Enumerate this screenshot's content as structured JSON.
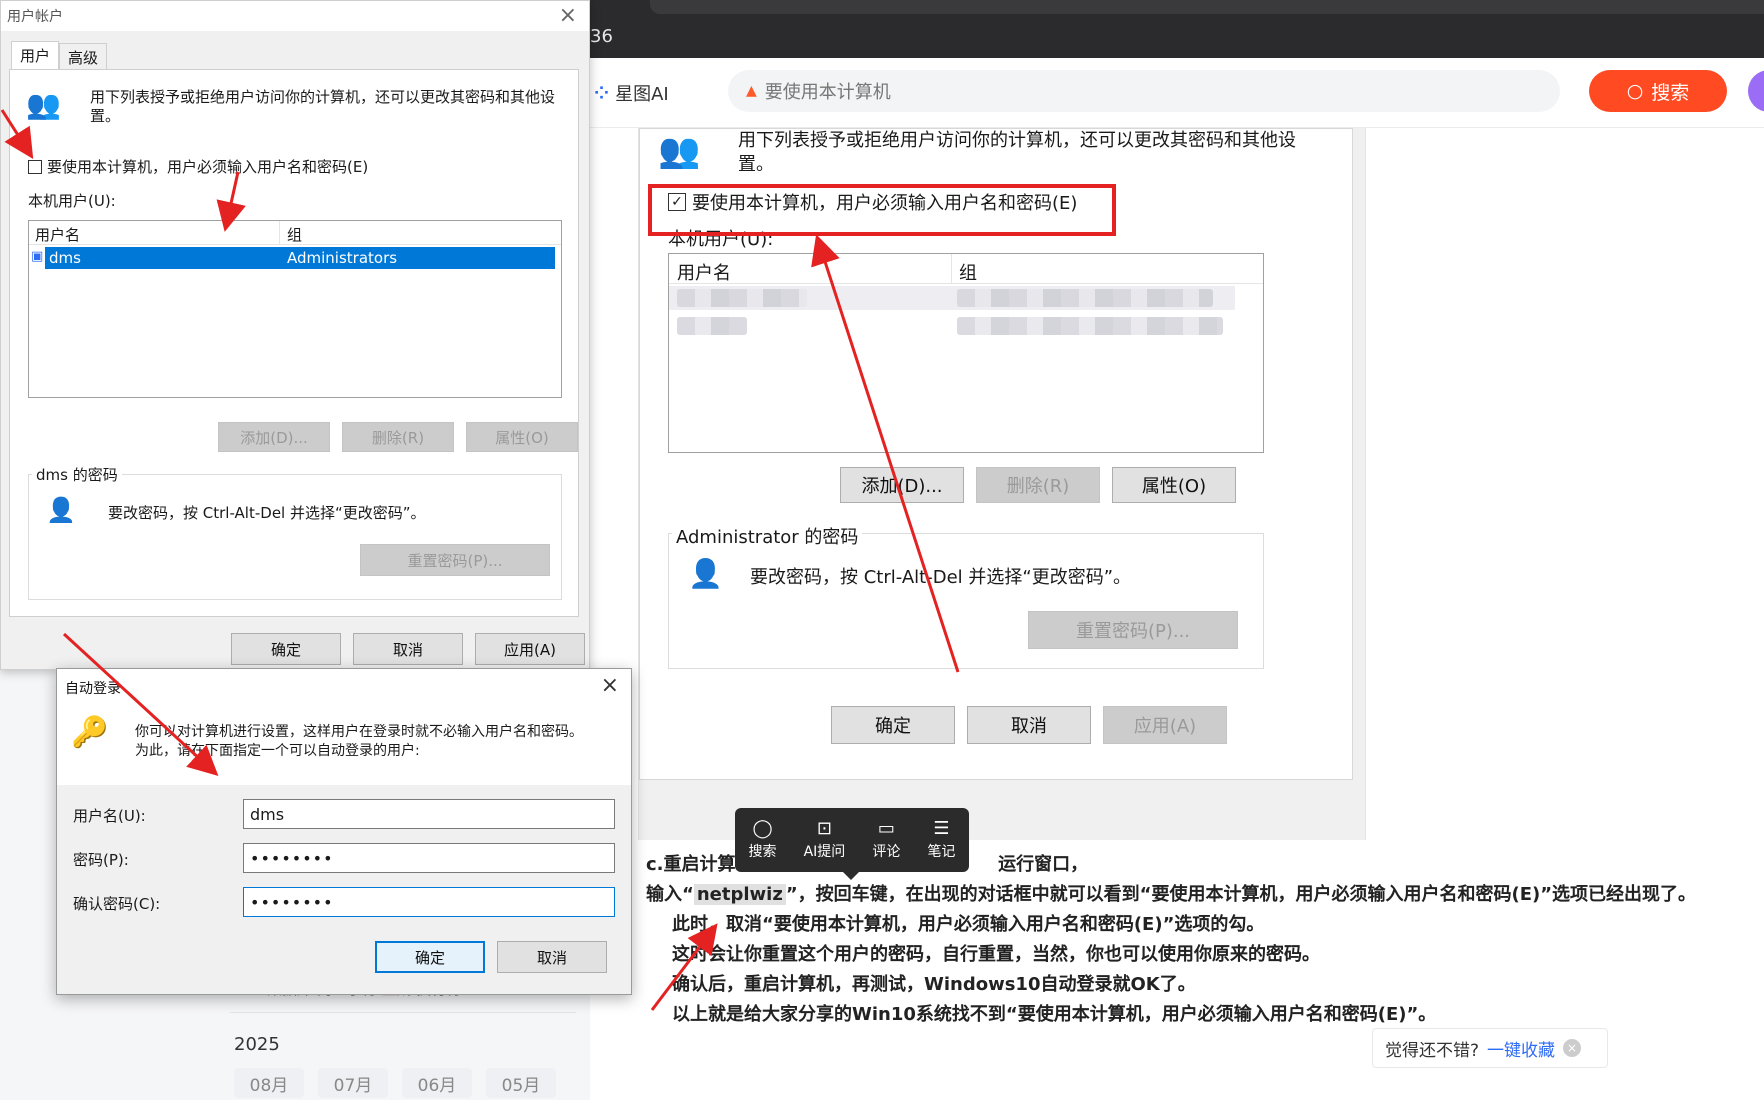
{
  "browser": {
    "url_fragment": "36"
  },
  "site": {
    "logo": "星图AI",
    "search_placeholder": "要使用本计算机",
    "search_button": "搜索",
    "ai_button": "AI"
  },
  "users_dialog": {
    "title": "用户帐户",
    "tabs": [
      "用户",
      "高级"
    ],
    "intro": "用下列表授予或拒绝用户访问你的计算机，还可以更改其密码和其他设置。",
    "checkbox_label": "要使用本计算机，用户必须输入用户名和密码(E)",
    "local_users_label": "本机用户(U):",
    "columns": [
      "用户名",
      "组"
    ],
    "rows": [
      {
        "user": "dms",
        "group": "Administrators"
      }
    ],
    "add_button": "添加(D)...",
    "remove_button": "删除(R)",
    "properties_button": "属性(O)",
    "password_group": "dms 的密码",
    "password_text": "要改密码，按 Ctrl-Alt-Del 并选择“更改密码”。",
    "reset_button": "重置密码(P)...",
    "ok": "确定",
    "cancel": "取消",
    "apply": "应用(A)"
  },
  "autologon_dialog": {
    "title": "自动登录",
    "desc_line1": "你可以对计算机进行设置，这样用户在登录时就不必输入用户名和密码。",
    "desc_line2": "为此，请在下面指定一个可以自动登录的用户:",
    "username_label": "用户名(U):",
    "username_value": "dms",
    "password_label": "密码(P):",
    "password_value": "••••••••",
    "confirm_label": "确认密码(C):",
    "confirm_value": "••••••••",
    "ok": "确定",
    "cancel": "取消"
  },
  "article_shot": {
    "intro_line1": "用下列表授予或拒绝用户访问你的计算机，还可以更改其密码和其他设",
    "intro_line2": "置。",
    "checkbox_label": "要使用本计算机，用户必须输入用户名和密码(E)",
    "local_users_label": "本机用户(U):",
    "columns": [
      "用户名",
      "组"
    ],
    "add_button": "添加(D)...",
    "remove_button": "删除(R)",
    "properties_button": "属性(O)",
    "password_group": "Administrator 的密码",
    "password_text": "要改密码，按 Ctrl-Alt-Del 并选择“更改密码”。",
    "reset_button": "重置密码(P)...",
    "ok": "确定",
    "cancel": "取消",
    "apply": "应用(A)"
  },
  "float_toolbar": [
    "搜索",
    "AI提问",
    "评论",
    "笔记"
  ],
  "article_text": {
    "line1_a": "c.重启计算",
    "line1_b": "运行窗口，",
    "line2_a": "输入“",
    "line2_word": "netplwiz",
    "line2_b": "”，按回车键，在出现的对话框中就可以看到“要使用本计算机，用户必须输入用户名和密码(E)”选项已经出现了。",
    "line3": "此时，取消“要使用本计算机，用户必须输入用户名和密码(E)”选项的勾。",
    "line4": "这时会让你重置这个用户的密码，自行重置，当然，你也可以使用你原来的密码。",
    "line5": "确认后，重启计算机，再测试，Windows10自动登录就OK了。",
    "line6": "以上就是给大家分享的Win10系统找不到“要使用本计算机，用户必须输入用户名和密码(E)”。"
  },
  "sidebar": {
    "partial_text": "Ideo 数据库 内置子符 生成 执行符",
    "year": "2025",
    "months": [
      "08月",
      "07月",
      "06月",
      "05月"
    ]
  },
  "like_box": {
    "text": "觉得还不错?",
    "link": "一键收藏",
    "close": "×"
  },
  "colors": {
    "accent_red": "#e52222",
    "search_orange": "#ff4a22",
    "ai_purple": "#9b6cf5",
    "selection_blue": "#0078d7"
  }
}
